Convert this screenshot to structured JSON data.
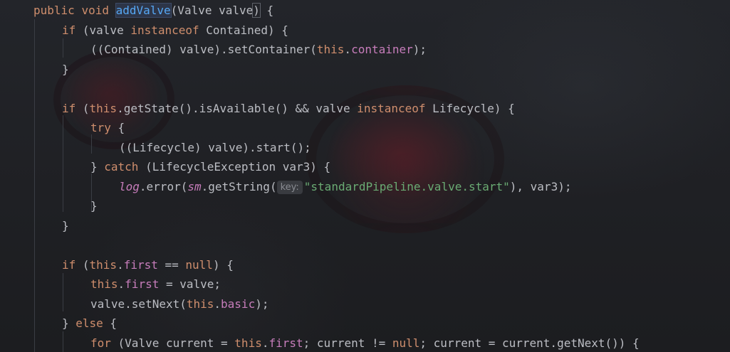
{
  "colors": {
    "background": "#1e1f22",
    "default_text": "#bcbec4",
    "keyword": "#cf8e6d",
    "method_declaration": "#56a8f5",
    "field": "#c77dbb",
    "string": "#6aab73",
    "inlay_hint_bg": "#393b40",
    "inlay_hint_text": "#8a8c92"
  },
  "code": {
    "line1": {
      "kw_public": "public",
      "kw_void": "void",
      "method_name": "addValve",
      "params": "(Valve valve",
      "close_paren": ")",
      "brace": " {"
    },
    "line2": {
      "kw_if": "if",
      "p1": " (valve ",
      "kw_instanceof": "instanceof",
      "p2": " Contained) {"
    },
    "line3": {
      "p1": "((Contained) valve).setContainer(",
      "kw_this": "this",
      "dot": ".",
      "field": "container",
      "p2": ");"
    },
    "line4": {
      "brace": "}"
    },
    "line6": {
      "kw_if": "if",
      "p1": " (",
      "kw_this": "this",
      "p2": ".getState().isAvailable() && valve ",
      "kw_instanceof": "instanceof",
      "p3": " Lifecycle) {"
    },
    "line7": {
      "kw_try": "try",
      "p1": " {"
    },
    "line8": {
      "p1": "((Lifecycle) valve).start();"
    },
    "line9": {
      "p1": "} ",
      "kw_catch": "catch",
      "p2": " (LifecycleException var3) {"
    },
    "line10": {
      "field_log": "log",
      "p1": ".error(",
      "field_sm": "sm",
      "p2": ".getString(",
      "hint": "key:",
      "string": "\"standardPipeline.valve.start\"",
      "p3": "), var3);"
    },
    "line11": {
      "brace": "}"
    },
    "line12": {
      "brace": "}"
    },
    "line14": {
      "kw_if": "if",
      "p1": " (",
      "kw_this": "this",
      "dot": ".",
      "field": "first",
      "p2": " == ",
      "kw_null": "null",
      "p3": ") {"
    },
    "line15": {
      "kw_this": "this",
      "dot": ".",
      "field": "first",
      "p1": " = valve;"
    },
    "line16": {
      "p1": "valve.setNext(",
      "kw_this": "this",
      "dot": ".",
      "field": "basic",
      "p2": ");"
    },
    "line17": {
      "p1": "} ",
      "kw_else": "else",
      "p2": " {"
    },
    "line18": {
      "kw_for": "for",
      "p1": " (Valve current = ",
      "kw_this": "this",
      "dot": ".",
      "field": "first",
      "p2": "; current != ",
      "kw_null": "null",
      "p3": "; current = current.getNext()) {"
    }
  }
}
